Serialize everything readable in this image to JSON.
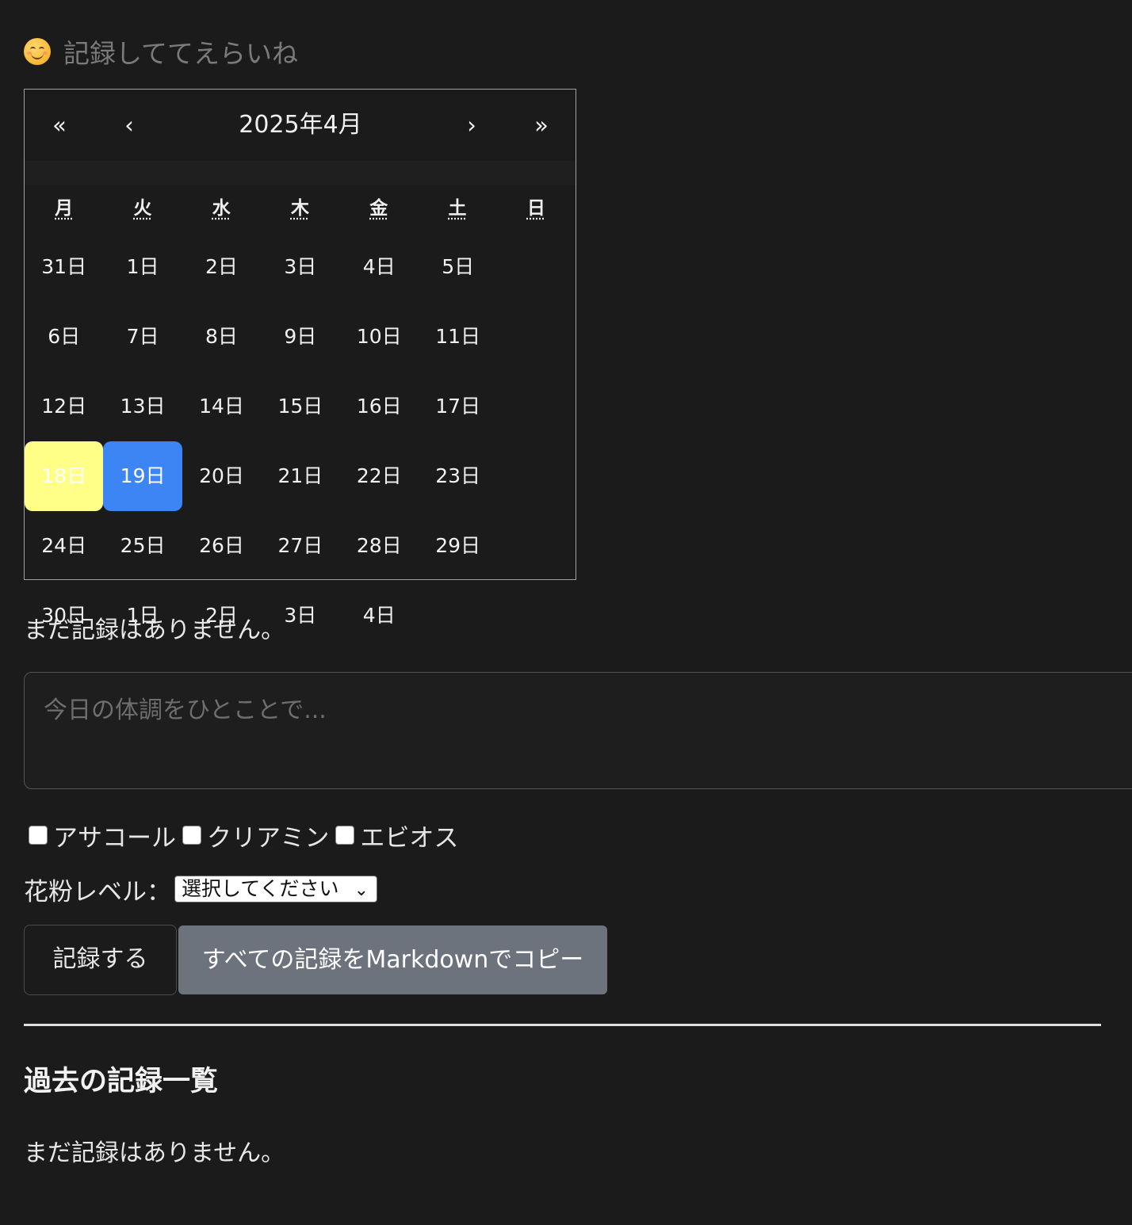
{
  "header": {
    "icon": "smiley-face-icon",
    "title": "記録しててえらいね"
  },
  "calendar": {
    "nav": {
      "prev_year": "«",
      "prev_month": "‹",
      "label": "2025年4月",
      "next_month": "›",
      "next_year": "»"
    },
    "weekdays": [
      "月",
      "火",
      "水",
      "木",
      "金",
      "土",
      "日"
    ],
    "days": [
      "31日",
      "1日",
      "2日",
      "3日",
      "4日",
      "5日",
      "6日",
      "7日",
      "8日",
      "9日",
      "10日",
      "11日",
      "12日",
      "13日",
      "14日",
      "15日",
      "16日",
      "17日",
      "18日",
      "19日",
      "20日",
      "21日",
      "22日",
      "23日",
      "24日",
      "25日",
      "26日",
      "27日",
      "28日",
      "29日",
      "30日",
      "1日",
      "2日",
      "3日",
      "4日"
    ],
    "today_index": 18,
    "selected_index": 19,
    "colors": {
      "today": "#ffff88",
      "selected": "#3d84f5"
    }
  },
  "status": {
    "no_records": "まだ記録はありません。"
  },
  "form": {
    "memo_placeholder": "今日の体調をひとことで...",
    "medications": [
      {
        "label": "アサコール",
        "checked": false
      },
      {
        "label": "クリアミン",
        "checked": false
      },
      {
        "label": "エビオス",
        "checked": false
      }
    ],
    "pollen_label": "花粉レベル：",
    "pollen_selected": "選択してください",
    "record_button": "記録する",
    "copy_button": "すべての記録をMarkdownでコピー",
    "copy_button_color": "#6c737d"
  },
  "history": {
    "title": "過去の記録一覧",
    "empty": "まだ記録はありません。"
  }
}
